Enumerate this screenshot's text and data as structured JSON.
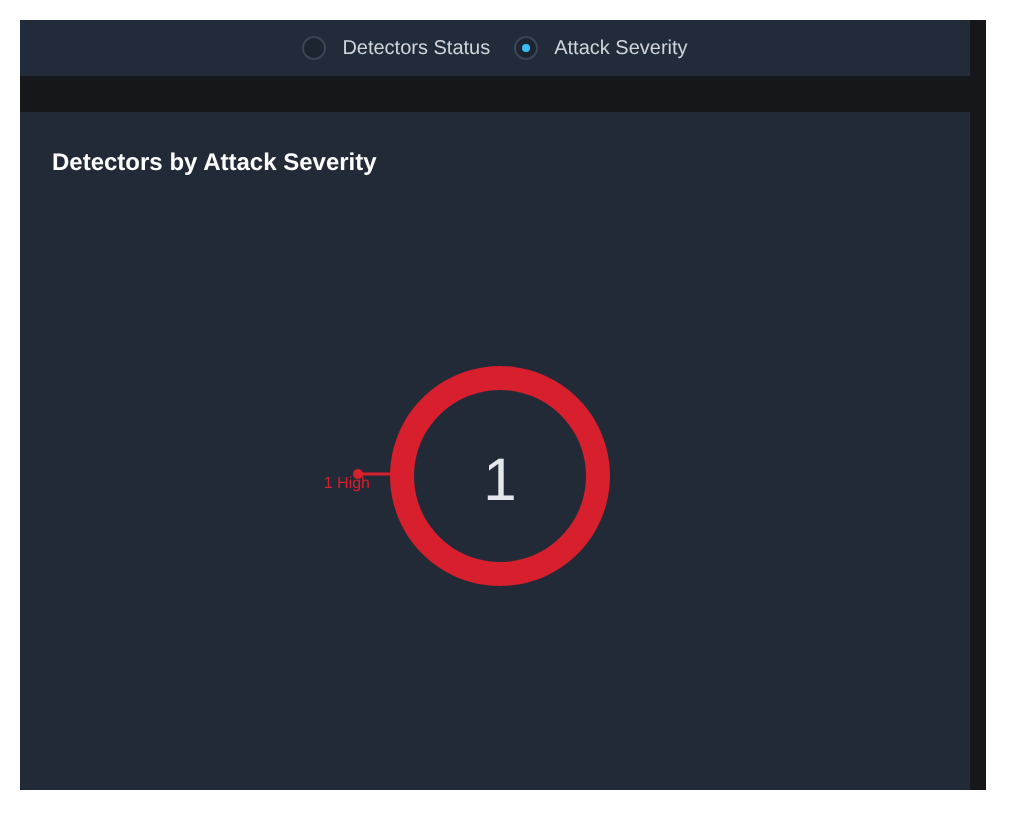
{
  "view_options": [
    {
      "label": "Detectors Status",
      "selected": false
    },
    {
      "label": "Attack Severity",
      "selected": true
    }
  ],
  "panel": {
    "title": "Detectors by Attack Severity",
    "center_label": "1",
    "segment_label": "1 High"
  }
}
